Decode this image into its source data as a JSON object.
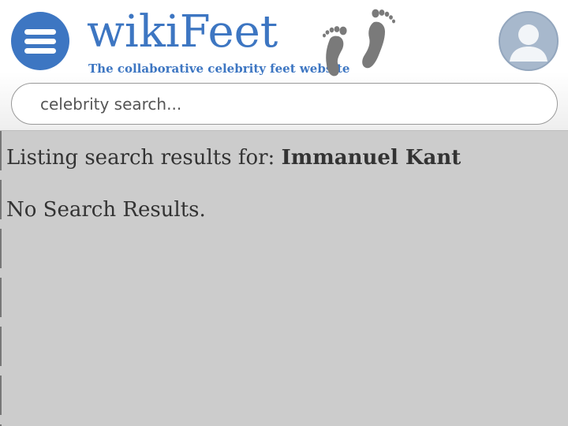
{
  "header": {
    "logo_title": "wikiFeet",
    "logo_tagline": "The collaborative celebrity feet website",
    "logo_icon": "footprints-icon",
    "menu_icon": "hamburger-menu-icon",
    "avatar_icon": "user-avatar-icon"
  },
  "search": {
    "placeholder": "celebrity search...",
    "value": ""
  },
  "results": {
    "prefix": "Listing search results for: ",
    "query": "Immanuel Kant",
    "empty_message": "No Search Results."
  },
  "colors": {
    "brand_blue": "#3d76c2",
    "page_background": "#cccccc",
    "header_background": "#ffffff",
    "avatar_background": "#a7b8cc",
    "text": "#333333"
  }
}
